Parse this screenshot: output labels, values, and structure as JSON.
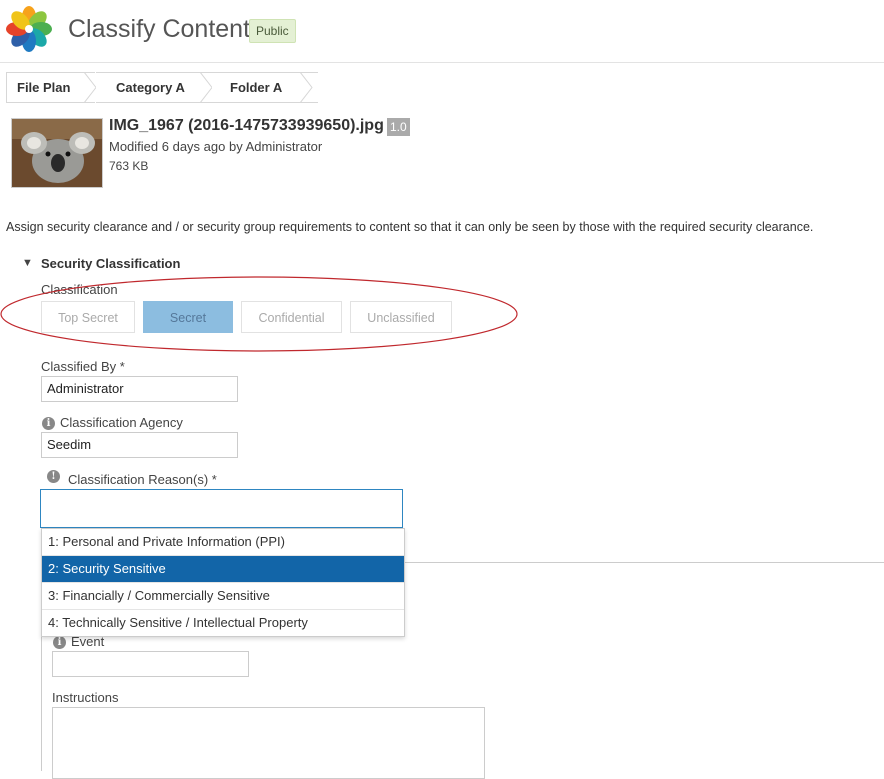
{
  "header": {
    "title": "Classify Content",
    "badge": "Public"
  },
  "breadcrumb": [
    "File Plan",
    "Category A",
    "Folder A"
  ],
  "file": {
    "name": "IMG_1967 (2016-1475733939650).jpg",
    "version": "1.0",
    "modified": "Modified 6 days ago by Administrator",
    "size": "763 KB"
  },
  "description": "Assign security clearance and / or security group requirements to content so that it can only be seen by those with the required security clearance.",
  "section": {
    "title": "Security Classification",
    "classification_label": "Classification",
    "levels": [
      "Top Secret",
      "Secret",
      "Confidential",
      "Unclassified"
    ],
    "selected_level": "Secret"
  },
  "form": {
    "classified_by_label": "Classified By *",
    "classified_by_value": "Administrator",
    "agency_label": "Classification Agency",
    "agency_value": "Seedim",
    "reasons_label": "Classification Reason(s) *",
    "reasons_value": "",
    "reason_options": [
      "1: Personal and Private Information (PPI)",
      "2: Security Sensitive",
      "3: Financially / Commercially Sensitive",
      "4: Technically Sensitive / Intellectual Property"
    ],
    "highlighted_option": "2: Security Sensitive",
    "event_label": "Event",
    "event_value": "",
    "instructions_label": "Instructions",
    "instructions_value": ""
  },
  "colors": {
    "selected_level_bg": "#8cbde0",
    "highlight_option_bg": "#1265a8",
    "annotation_ellipse": "#c0282d",
    "badge_bg": "#e4f0d4"
  },
  "icons": {
    "logo": "alfresco-flower-logo",
    "section_toggle": "triangle-down-icon",
    "info": "info-circle-icon",
    "warning": "exclamation-circle-icon"
  }
}
